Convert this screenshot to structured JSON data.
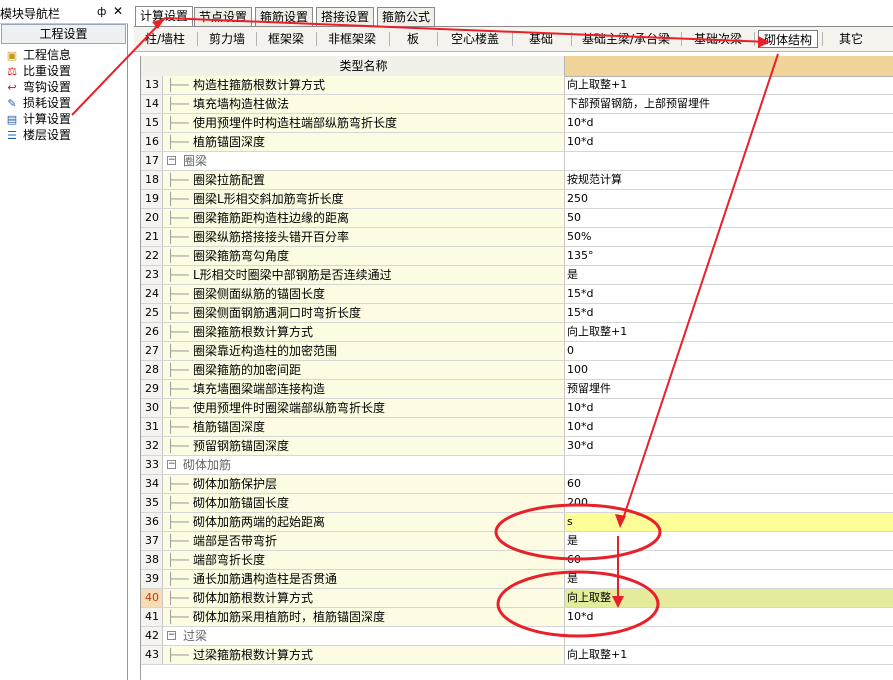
{
  "nav": {
    "title": "模块导航栏",
    "pin": "ф",
    "close": "✕",
    "section": "工程设置",
    "items": [
      {
        "label": "工程信息",
        "icon": "folder-icon"
      },
      {
        "label": "比重设置",
        "icon": "scale-icon"
      },
      {
        "label": "弯钩设置",
        "icon": "hook-icon"
      },
      {
        "label": "损耗设置",
        "icon": "loss-icon"
      },
      {
        "label": "计算设置",
        "icon": "calc-settings-icon"
      },
      {
        "label": "楼层设置",
        "icon": "floors-icon"
      }
    ]
  },
  "tabs": [
    "计算设置",
    "节点设置",
    "箍筋设置",
    "搭接设置",
    "箍筋公式"
  ],
  "subtabs": [
    "柱/墙柱",
    "剪力墙",
    "框架梁",
    "非框架梁",
    "板",
    "空心楼盖",
    "基础",
    "基础主梁/承台梁",
    "基础次梁",
    "砌体结构",
    "其它"
  ],
  "grid": {
    "header": "类型名称",
    "rows": [
      {
        "num": "13",
        "name": "构造柱箍筋根数计算方式",
        "value": "向上取整+1"
      },
      {
        "num": "14",
        "name": "填充墙构造柱做法",
        "value": "下部预留钢筋，上部预留埋件"
      },
      {
        "num": "15",
        "name": "使用预埋件时构造柱端部纵筋弯折长度",
        "value": "10*d"
      },
      {
        "num": "16",
        "name": "植筋锚固深度",
        "value": "10*d"
      },
      {
        "num": "17",
        "name": "圈梁",
        "value": "",
        "group": true
      },
      {
        "num": "18",
        "name": "圈梁拉筋配置",
        "value": "按规范计算"
      },
      {
        "num": "19",
        "name": "圈梁L形相交斜加筋弯折长度",
        "value": "250"
      },
      {
        "num": "20",
        "name": "圈梁箍筋距构造柱边缘的距离",
        "value": "50"
      },
      {
        "num": "21",
        "name": "圈梁纵筋搭接接头错开百分率",
        "value": "50%"
      },
      {
        "num": "22",
        "name": "圈梁箍筋弯勾角度",
        "value": "135°"
      },
      {
        "num": "23",
        "name": "L形相交时圈梁中部钢筋是否连续通过",
        "value": "是"
      },
      {
        "num": "24",
        "name": "圈梁侧面纵筋的锚固长度",
        "value": "15*d"
      },
      {
        "num": "25",
        "name": "圈梁侧面钢筋遇洞口时弯折长度",
        "value": "15*d"
      },
      {
        "num": "26",
        "name": "圈梁箍筋根数计算方式",
        "value": "向上取整+1"
      },
      {
        "num": "27",
        "name": "圈梁靠近构造柱的加密范围",
        "value": "0"
      },
      {
        "num": "28",
        "name": "圈梁箍筋的加密间距",
        "value": "100"
      },
      {
        "num": "29",
        "name": "填充墙圈梁端部连接构造",
        "value": "预留埋件"
      },
      {
        "num": "30",
        "name": "使用预埋件时圈梁端部纵筋弯折长度",
        "value": "10*d"
      },
      {
        "num": "31",
        "name": "植筋锚固深度",
        "value": "10*d"
      },
      {
        "num": "32",
        "name": "预留钢筋锚固深度",
        "value": "30*d"
      },
      {
        "num": "33",
        "name": "砌体加筋",
        "value": "",
        "group": true
      },
      {
        "num": "34",
        "name": "砌体加筋保护层",
        "value": "60"
      },
      {
        "num": "35",
        "name": "砌体加筋锚固长度",
        "value": "200"
      },
      {
        "num": "36",
        "name": "砌体加筋两端的起始距离",
        "value": "s",
        "hl": "val"
      },
      {
        "num": "37",
        "name": "端部是否带弯折",
        "value": "是"
      },
      {
        "num": "38",
        "name": "端部弯折长度",
        "value": "60"
      },
      {
        "num": "39",
        "name": "通长加筋遇构造柱是否贯通",
        "value": "是"
      },
      {
        "num": "40",
        "name": "砌体加筋根数计算方式",
        "value": "向上取整",
        "hl": "row"
      },
      {
        "num": "41",
        "name": "砌体加筋采用植筋时，植筋锚固深度",
        "value": "10*d"
      },
      {
        "num": "42",
        "name": "过梁",
        "value": "",
        "group": true
      },
      {
        "num": "43",
        "name": "过梁箍筋根数计算方式",
        "value": "向上取整+1"
      }
    ]
  },
  "annotation_color": "#e8202a"
}
